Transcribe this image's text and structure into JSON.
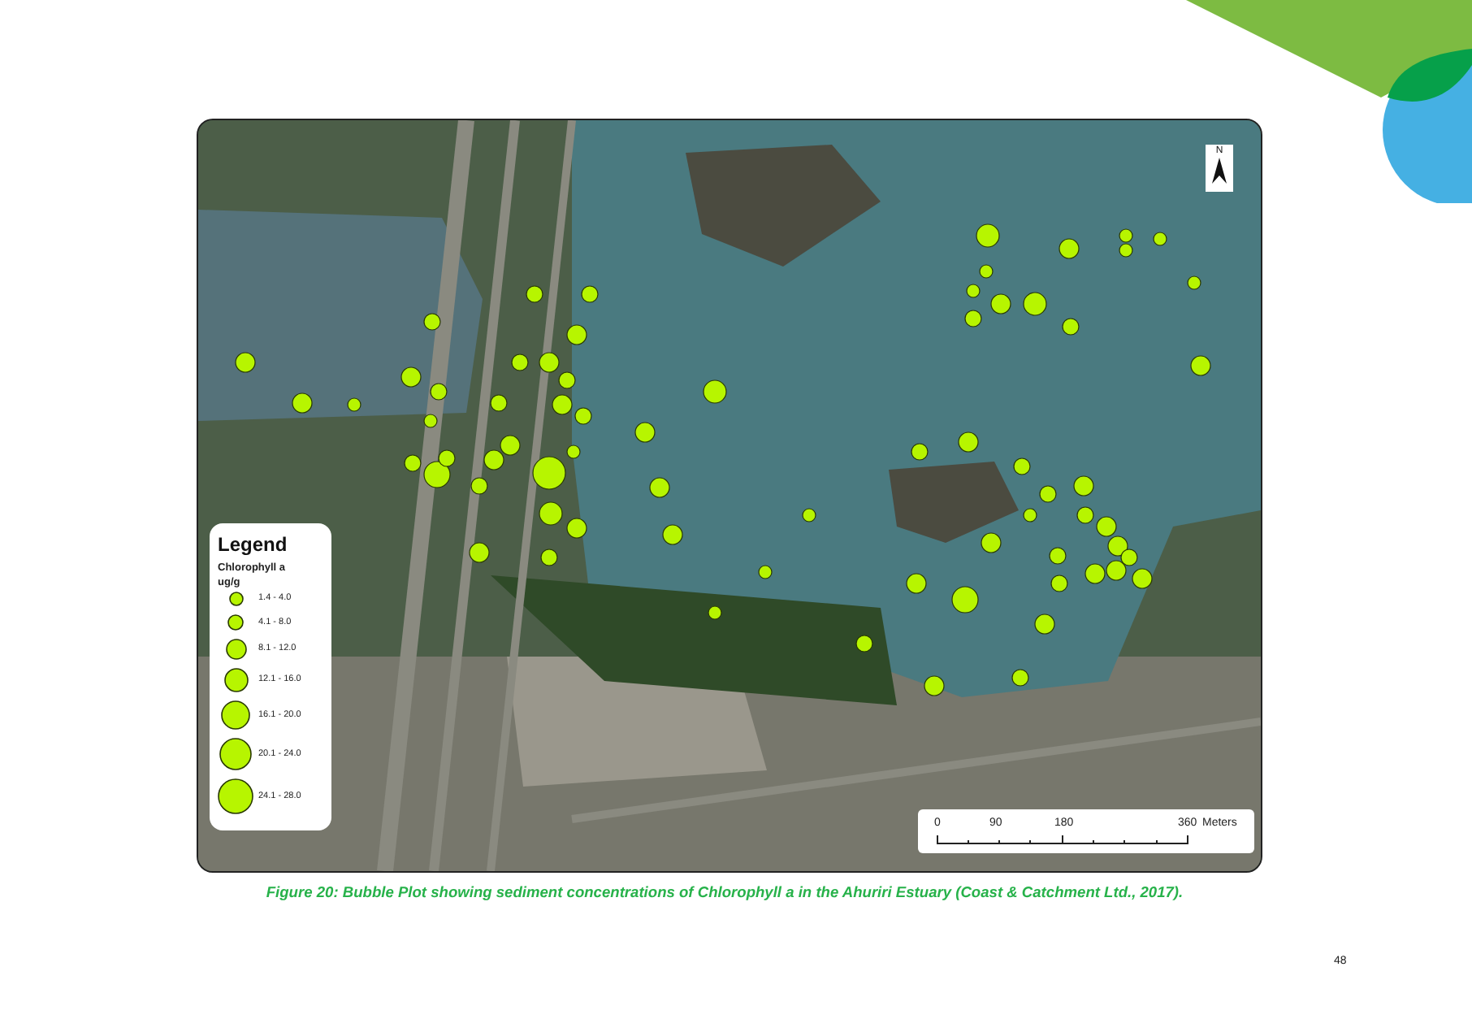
{
  "map": {
    "north_label": "N",
    "legend": {
      "title": "Legend",
      "field": "Chlorophyll a",
      "unit": "ug/g",
      "classes": [
        {
          "label": "1.4 - 4.0"
        },
        {
          "label": "4.1 - 8.0"
        },
        {
          "label": "8.1 - 12.0"
        },
        {
          "label": "12.1 - 16.0"
        },
        {
          "label": "16.1 - 20.0"
        },
        {
          "label": "20.1 - 24.0"
        },
        {
          "label": "24.1 - 28.0"
        }
      ]
    },
    "scale_bar": {
      "ticks": [
        "0",
        "90",
        "180",
        "360"
      ],
      "unit": "Meters"
    }
  },
  "caption": "Figure 20: Bubble Plot showing sediment concentrations of Chlorophyll a in the Ahuriri Estuary (Coast & Catchment Ltd., 2017).",
  "page_number": "48"
}
